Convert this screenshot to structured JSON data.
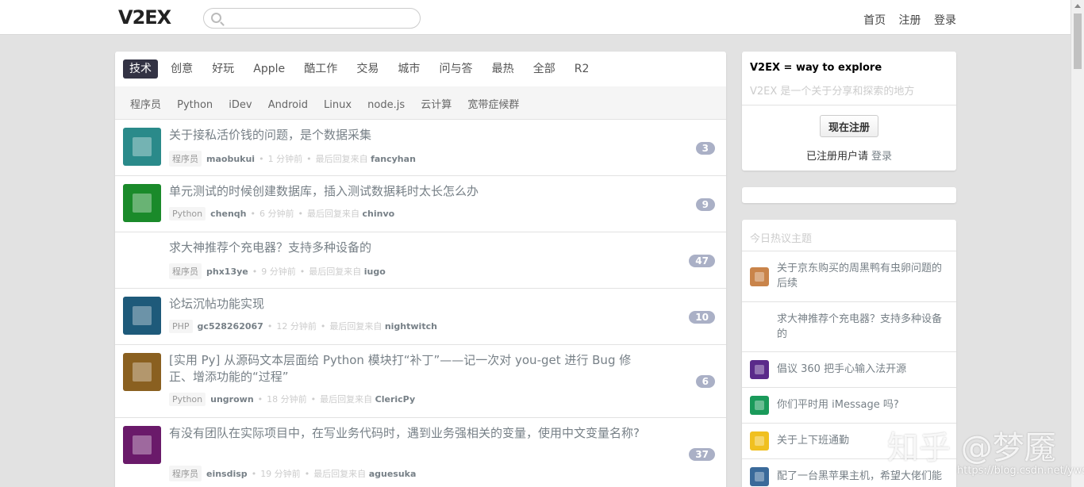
{
  "header": {
    "logo": "V2EX",
    "search_placeholder": "",
    "nav": [
      "首页",
      "注册",
      "登录"
    ]
  },
  "tabs": [
    "技术",
    "创意",
    "好玩",
    "Apple",
    "酷工作",
    "交易",
    "城市",
    "问与答",
    "最热",
    "全部",
    "R2"
  ],
  "active_tab": "技术",
  "subtabs": [
    "程序员",
    "Python",
    "iDev",
    "Android",
    "Linux",
    "node.js",
    "云计算",
    "宽带症候群"
  ],
  "topics": [
    {
      "title": "关于接私活价钱的问题，是个数据采集",
      "node": "程序员",
      "author": "maobukui",
      "time": "1 分钟前",
      "last_label": "最后回复来自",
      "last_user": "fancyhan",
      "count": "3",
      "avatar_color": "#2a8a8a"
    },
    {
      "title": "单元测试的时候创建数据库，插入测试数据耗时太长怎么办",
      "node": "Python",
      "author": "chenqh",
      "time": "6 分钟前",
      "last_label": "最后回复来自",
      "last_user": "chinvo",
      "count": "9",
      "avatar_color": "#1a8a2a"
    },
    {
      "title": "求大神推荐个充电器？支持多种设备的",
      "node": "程序员",
      "author": "phx13ye",
      "time": "9 分钟前",
      "last_label": "最后回复来自",
      "last_user": "iugo",
      "count": "47",
      "avatar_color": "#ffffff"
    },
    {
      "title": "论坛沉帖功能实现",
      "node": "PHP",
      "author": "gc528262067",
      "time": "12 分钟前",
      "last_label": "最后回复来自",
      "last_user": "nightwitch",
      "count": "10",
      "avatar_color": "#1e5a7a"
    },
    {
      "title": "[实用 Py] 从源码文本层面给 Python 模块打“补丁”——记一次对 you-get 进行 Bug 修正、增添功能的“过程”",
      "node": "Python",
      "author": "ungrown",
      "time": "18 分钟前",
      "last_label": "最后回复来自",
      "last_user": "ClericPy",
      "count": "6",
      "avatar_color": "#8a6020"
    },
    {
      "title": "有没有团队在实际项目中，在写业务代码时，遇到业务强相关的变量，使用中文变量名称?",
      "node": "程序员",
      "author": "einsdisp",
      "time": "19 分钟前",
      "last_label": "最后回复来自",
      "last_user": "aguesuka",
      "count": "37",
      "avatar_color": "#6a1a6a"
    }
  ],
  "sidebar": {
    "slogan": "V2EX = way to explore",
    "description": "V2EX 是一个关于分享和探索的地方",
    "register_button": "现在注册",
    "registered_text": "已注册用户请",
    "login_link": "登录",
    "hot_title": "今日热议主题",
    "hot_items": [
      {
        "text": "关于京东购买的周黑鸭有虫卵问题的后续",
        "color": "#c9844a"
      },
      {
        "text": "求大神推荐个充电器？支持多种设备的",
        "color": "#ffffff"
      },
      {
        "text": "倡议 360 把手心输入法开源",
        "color": "#5a2a8a"
      },
      {
        "text": "你们平时用 iMessage 吗?",
        "color": "#1a9a5a"
      },
      {
        "text": "关于上下班通勤",
        "color": "#f0c020"
      },
      {
        "text": "配了一台黑苹果主机，希望大佬们能",
        "color": "#3a6a9a"
      }
    ]
  },
  "watermark": {
    "text": "知乎 @梦魇",
    "url": "https://blog.csdn.net/ywsydwsbn"
  }
}
